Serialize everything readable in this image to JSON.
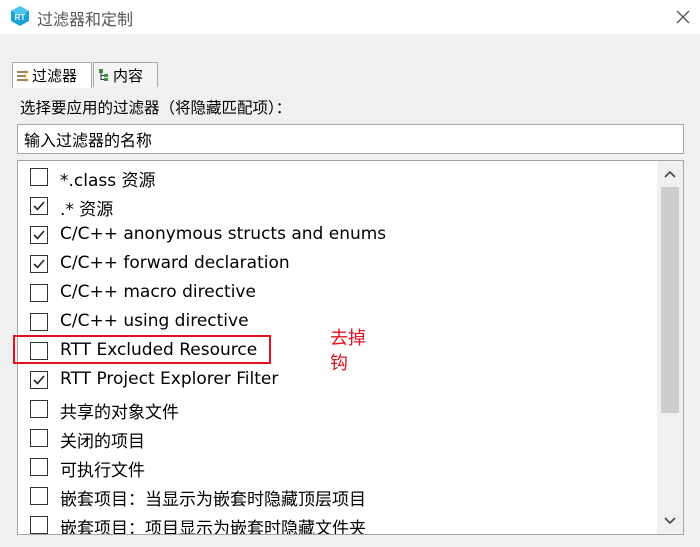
{
  "window": {
    "title": "过滤器和定制",
    "icon": "rt-logo-icon",
    "close_icon": "close-icon"
  },
  "tabs": [
    {
      "label": "过滤器",
      "icon": "filter-icon",
      "active": true
    },
    {
      "label": "内容",
      "icon": "content-tree-icon",
      "active": false
    }
  ],
  "prompt": "选择要应用的过滤器（将隐藏匹配项）：",
  "filter_input": {
    "value": "输入过滤器的名称"
  },
  "filters": [
    {
      "label": "*.class 资源",
      "checked": false
    },
    {
      "label": ".* 资源",
      "checked": true
    },
    {
      "label": "C/C++ anonymous structs and enums",
      "checked": true
    },
    {
      "label": "C/C++ forward declaration",
      "checked": true
    },
    {
      "label": "C/C++ macro directive",
      "checked": false
    },
    {
      "label": "C/C++ using directive",
      "checked": false
    },
    {
      "label": "RTT Excluded Resource",
      "checked": false
    },
    {
      "label": "RTT Project Explorer Filter",
      "checked": true
    },
    {
      "label": "共享的对象文件",
      "checked": false
    },
    {
      "label": "关闭的项目",
      "checked": false
    },
    {
      "label": "可执行文件",
      "checked": false
    },
    {
      "label": "嵌套项目：当显示为嵌套时隐藏顶层项目",
      "checked": false
    },
    {
      "label": "嵌套项目：项目显示为嵌套时隐藏文件夹",
      "checked": false
    }
  ],
  "annotation": {
    "text": "去掉钩",
    "color": "#e0101e"
  },
  "colors": {
    "accent_icon": "#1aa3d9",
    "highlight": "#e0101e"
  }
}
